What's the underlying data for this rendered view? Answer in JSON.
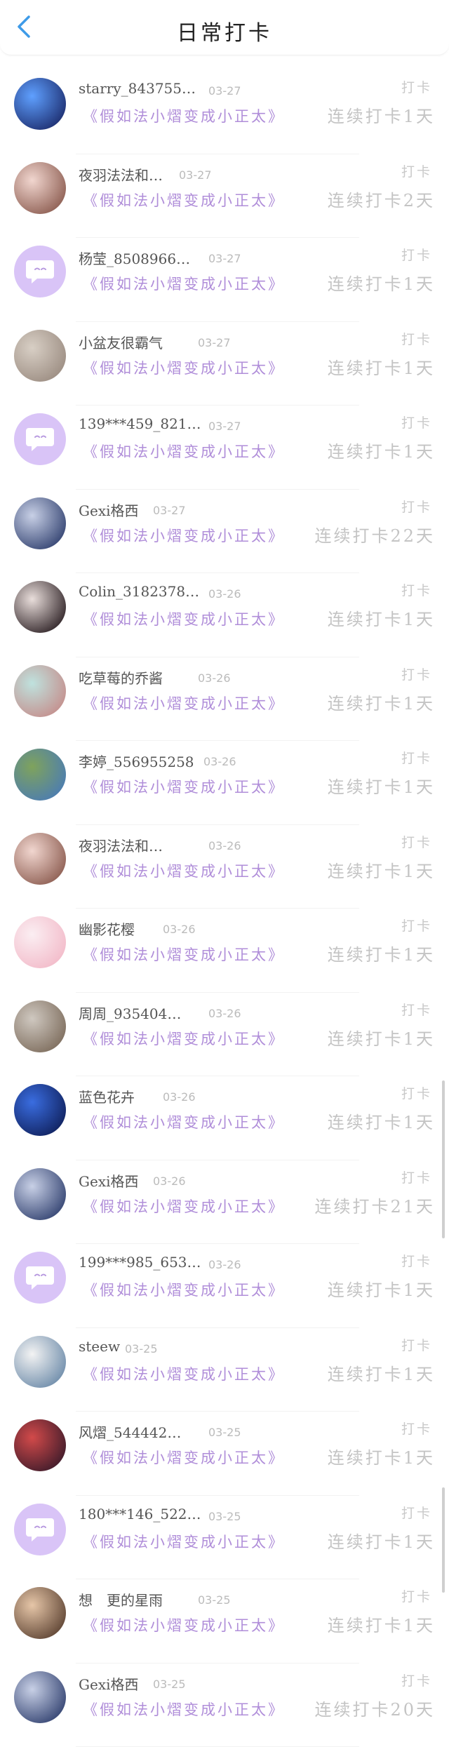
{
  "header": {
    "title": "日常打卡"
  },
  "colors": {
    "accent_back": "#3e9be8",
    "book": "#b08ed9",
    "default_avatar": "#d9c4f7"
  },
  "items": [
    {
      "name": "starry_843755…",
      "date": "03-27",
      "book": "《假如法小熠变成小正太》",
      "action": "打卡",
      "streak": "连续打卡1天",
      "avatar": "space",
      "c1": "#1b2a6b",
      "c2": "#5fa0ff"
    },
    {
      "name": "夜羽法法和…",
      "date": "03-27",
      "book": "《假如法小熠变成小正太》",
      "action": "打卡",
      "streak": "连续打卡2天",
      "avatar": "photo",
      "c1": "#8a5a4e",
      "c2": "#f1d6cf"
    },
    {
      "name": "杨莹_8508966…",
      "date": "03-27",
      "book": "《假如法小熠变成小正太》",
      "action": "打卡",
      "streak": "连续打卡1天",
      "avatar": "default"
    },
    {
      "name": "小盆友很霸气",
      "date": "03-27",
      "book": "《假如法小熠变成小正太》",
      "action": "打卡",
      "streak": "连续打卡1天",
      "avatar": "photo",
      "c1": "#9a8b80",
      "c2": "#d8cfc5"
    },
    {
      "name": "139***459_821…",
      "date": "03-27",
      "book": "《假如法小熠变成小正太》",
      "action": "打卡",
      "streak": "连续打卡1天",
      "avatar": "default"
    },
    {
      "name": "Gexi格西",
      "date": "03-27",
      "book": "《假如法小熠变成小正太》",
      "action": "打卡",
      "streak": "连续打卡22天",
      "avatar": "photo",
      "c1": "#2f3f6e",
      "c2": "#c8d0e6"
    },
    {
      "name": "Colin_3182378…",
      "date": "03-26",
      "book": "《假如法小熠变成小正太》",
      "action": "打卡",
      "streak": "连续打卡1天",
      "avatar": "photo",
      "c1": "#2a1e22",
      "c2": "#e9dedb"
    },
    {
      "name": "吃草莓的乔酱",
      "date": "03-26",
      "book": "《假如法小熠变成小正太》",
      "action": "打卡",
      "streak": "连续打卡1天",
      "avatar": "photo",
      "c1": "#c58c8a",
      "c2": "#bfe2de"
    },
    {
      "name": "李婷_556955258",
      "date": "03-26",
      "book": "《假如法小熠变成小正太》",
      "action": "打卡",
      "streak": "连续打卡1天",
      "avatar": "photo",
      "c1": "#4a7bb5",
      "c2": "#7fa35c"
    },
    {
      "name": "夜羽法法和…",
      "date": "03-26",
      "book": "《假如法小熠变成小正太》",
      "action": "打卡",
      "streak": "连续打卡1天",
      "avatar": "photo",
      "c1": "#8a5a4e",
      "c2": "#f1d6cf"
    },
    {
      "name": "幽影花樱",
      "date": "03-26",
      "book": "《假如法小熠变成小正太》",
      "action": "打卡",
      "streak": "连续打卡1天",
      "avatar": "photo",
      "c1": "#f2b9c8",
      "c2": "#fbeef2"
    },
    {
      "name": "周周_935404…",
      "date": "03-26",
      "book": "《假如法小熠变成小正太》",
      "action": "打卡",
      "streak": "连续打卡1天",
      "avatar": "photo",
      "c1": "#7b6a5a",
      "c2": "#cfc8c0"
    },
    {
      "name": "蓝色花卉",
      "date": "03-26",
      "book": "《假如法小熠变成小正太》",
      "action": "打卡",
      "streak": "连续打卡1天",
      "avatar": "photo",
      "c1": "#0f1f5a",
      "c2": "#3a6de0"
    },
    {
      "name": "Gexi格西",
      "date": "03-26",
      "book": "《假如法小熠变成小正太》",
      "action": "打卡",
      "streak": "连续打卡21天",
      "avatar": "photo",
      "c1": "#2f3f6e",
      "c2": "#c8d0e6"
    },
    {
      "name": "199***985_653…",
      "date": "03-26",
      "book": "《假如法小熠变成小正太》",
      "action": "打卡",
      "streak": "连续打卡1天",
      "avatar": "default"
    },
    {
      "name": "steew",
      "date": "03-25",
      "book": "《假如法小熠变成小正太》",
      "action": "打卡",
      "streak": "连续打卡1天",
      "avatar": "photo",
      "c1": "#6a89a8",
      "c2": "#f3f3f3"
    },
    {
      "name": "风熠_544442…",
      "date": "03-25",
      "book": "《假如法小熠变成小正太》",
      "action": "打卡",
      "streak": "连续打卡1天",
      "avatar": "photo",
      "c1": "#3a1a2a",
      "c2": "#d24a4a"
    },
    {
      "name": "180***146_522…",
      "date": "03-25",
      "book": "《假如法小熠变成小正太》",
      "action": "打卡",
      "streak": "连续打卡1天",
      "avatar": "default"
    },
    {
      "name": "想　更的星雨",
      "date": "03-25",
      "book": "《假如法小熠变成小正太》",
      "action": "打卡",
      "streak": "连续打卡1天",
      "avatar": "photo",
      "c1": "#5a4030",
      "c2": "#e6c6a8"
    },
    {
      "name": "Gexi格西",
      "date": "03-25",
      "book": "《假如法小熠变成小正太》",
      "action": "打卡",
      "streak": "连续打卡20天",
      "avatar": "photo",
      "c1": "#2f3f6e",
      "c2": "#c8d0e6"
    }
  ]
}
